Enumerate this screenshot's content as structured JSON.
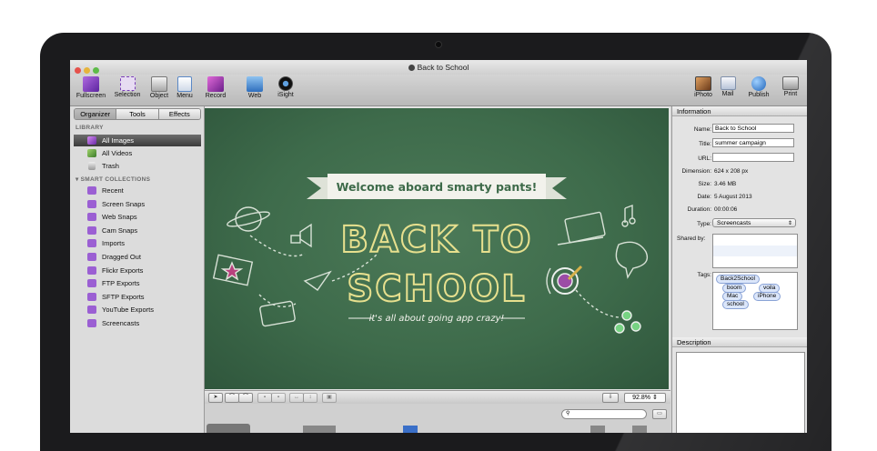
{
  "window": {
    "title": "Back to School"
  },
  "toolbar": {
    "left": [
      {
        "label": "Fullscreen",
        "icon": "fullscreen-icon",
        "color": "#7a3fb8"
      },
      {
        "label": "Selection",
        "icon": "selection-icon",
        "color": "#7a3fb8"
      },
      {
        "label": "Object",
        "icon": "object-icon",
        "color": "#9a9a9a"
      },
      {
        "label": "Menu",
        "icon": "menu-icon",
        "color": "#5a88c6"
      },
      {
        "label": "Record",
        "icon": "record-icon",
        "color": "#a0329c"
      },
      {
        "label": "Web",
        "icon": "web-icon",
        "color": "#3c79c8"
      },
      {
        "label": "iSight",
        "icon": "isight-icon",
        "color": "#222222"
      }
    ],
    "right": [
      {
        "label": "iPhoto",
        "icon": "iphoto-icon",
        "color": "#8a5a3a"
      },
      {
        "label": "Mail",
        "icon": "mail-icon",
        "color": "#b8c4d8"
      },
      {
        "label": "Publish",
        "icon": "publish-icon",
        "color": "#2f7bd1"
      },
      {
        "label": "Print",
        "icon": "print-icon",
        "color": "#a9a9a9"
      }
    ]
  },
  "sidebar": {
    "tabs": [
      "Organizer",
      "Tools",
      "Effects"
    ],
    "library_heading": "LIBRARY",
    "library": [
      {
        "label": "All Images",
        "selected": true
      },
      {
        "label": "All Videos"
      },
      {
        "label": "Trash"
      }
    ],
    "smart_heading": "SMART COLLECTIONS",
    "smart": [
      "Recent",
      "Screen Snaps",
      "Web Snaps",
      "Cam Snaps",
      "Imports",
      "Dragged Out",
      "Flickr Exports",
      "FTP Exports",
      "SFTP Exports",
      "YouTube Exports",
      "Screencasts"
    ]
  },
  "canvas": {
    "banner": "Welcome aboard smarty pants!",
    "headline1": "BACK TO",
    "headline2": "SCHOOL",
    "tagline": "it's all about going app crazy!",
    "zoom": "92.8%",
    "board_color": "#3e6b4b",
    "chalk_yellow": "#e7e08e"
  },
  "inspector": {
    "heading": "Information",
    "name_label": "Name:",
    "name": "Back to School",
    "title_label": "Title:",
    "title": "summer campaign",
    "url_label": "URL:",
    "url": "",
    "dimension_label": "Dimension:",
    "dimension": "624 x 208 px",
    "size_label": "Size:",
    "size": "3.46 MB",
    "date_label": "Date:",
    "date": "5 August 2013",
    "duration_label": "Duration:",
    "duration": "00:00:06",
    "type_label": "Type:",
    "type": "Screencasts",
    "shared_label": "Shared by:",
    "tags_label": "Tags:",
    "tags": [
      "Back2School",
      "boom",
      "voila",
      "Mac",
      "iPhone",
      "school"
    ],
    "description_heading": "Description"
  }
}
